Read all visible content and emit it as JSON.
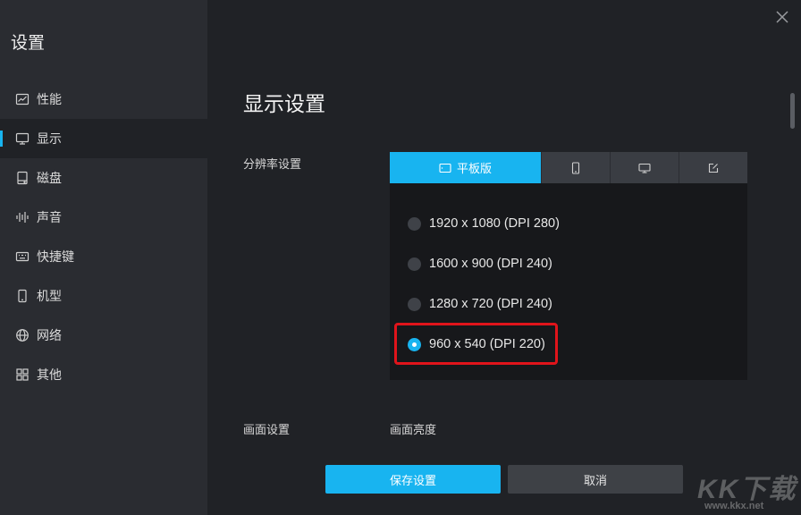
{
  "sidebar": {
    "title": "设置",
    "items": [
      {
        "label": "性能",
        "icon": "chart-icon",
        "active": false
      },
      {
        "label": "显示",
        "icon": "monitor-icon",
        "active": true
      },
      {
        "label": "磁盘",
        "icon": "disk-icon",
        "active": false
      },
      {
        "label": "声音",
        "icon": "sound-wave-icon",
        "active": false
      },
      {
        "label": "快捷键",
        "icon": "keyboard-icon",
        "active": false
      },
      {
        "label": "机型",
        "icon": "phone-icon",
        "active": false
      },
      {
        "label": "网络",
        "icon": "globe-icon",
        "active": false
      },
      {
        "label": "其他",
        "icon": "grid-icon",
        "active": false
      }
    ]
  },
  "main": {
    "title": "显示设置",
    "resolution": {
      "label": "分辨率设置",
      "tabs": [
        {
          "label": "平板版",
          "icon": "tablet-icon",
          "selected": true
        },
        {
          "label": "",
          "icon": "phone-icon",
          "selected": false
        },
        {
          "label": "",
          "icon": "monitor-icon",
          "selected": false
        },
        {
          "label": "",
          "icon": "edit-icon",
          "selected": false
        }
      ],
      "options": [
        {
          "label": "1920 x 1080 (DPI 280)",
          "checked": false
        },
        {
          "label": "1600 x 900 (DPI 240)",
          "checked": false
        },
        {
          "label": "1280 x 720 (DPI 240)",
          "checked": false
        },
        {
          "label": "960 x 540 (DPI 220)",
          "checked": true
        }
      ]
    },
    "screen": {
      "label": "画面设置",
      "brightness_label": "画面亮度"
    }
  },
  "footer": {
    "save_label": "保存设置",
    "cancel_label": "取消"
  },
  "watermark": {
    "logo": "KK下载",
    "url": "www.kkx.net"
  },
  "colors": {
    "accent": "#18b4f0",
    "highlight": "#e0141b",
    "sidebar_bg": "#2a2c31",
    "main_bg": "#202226"
  }
}
